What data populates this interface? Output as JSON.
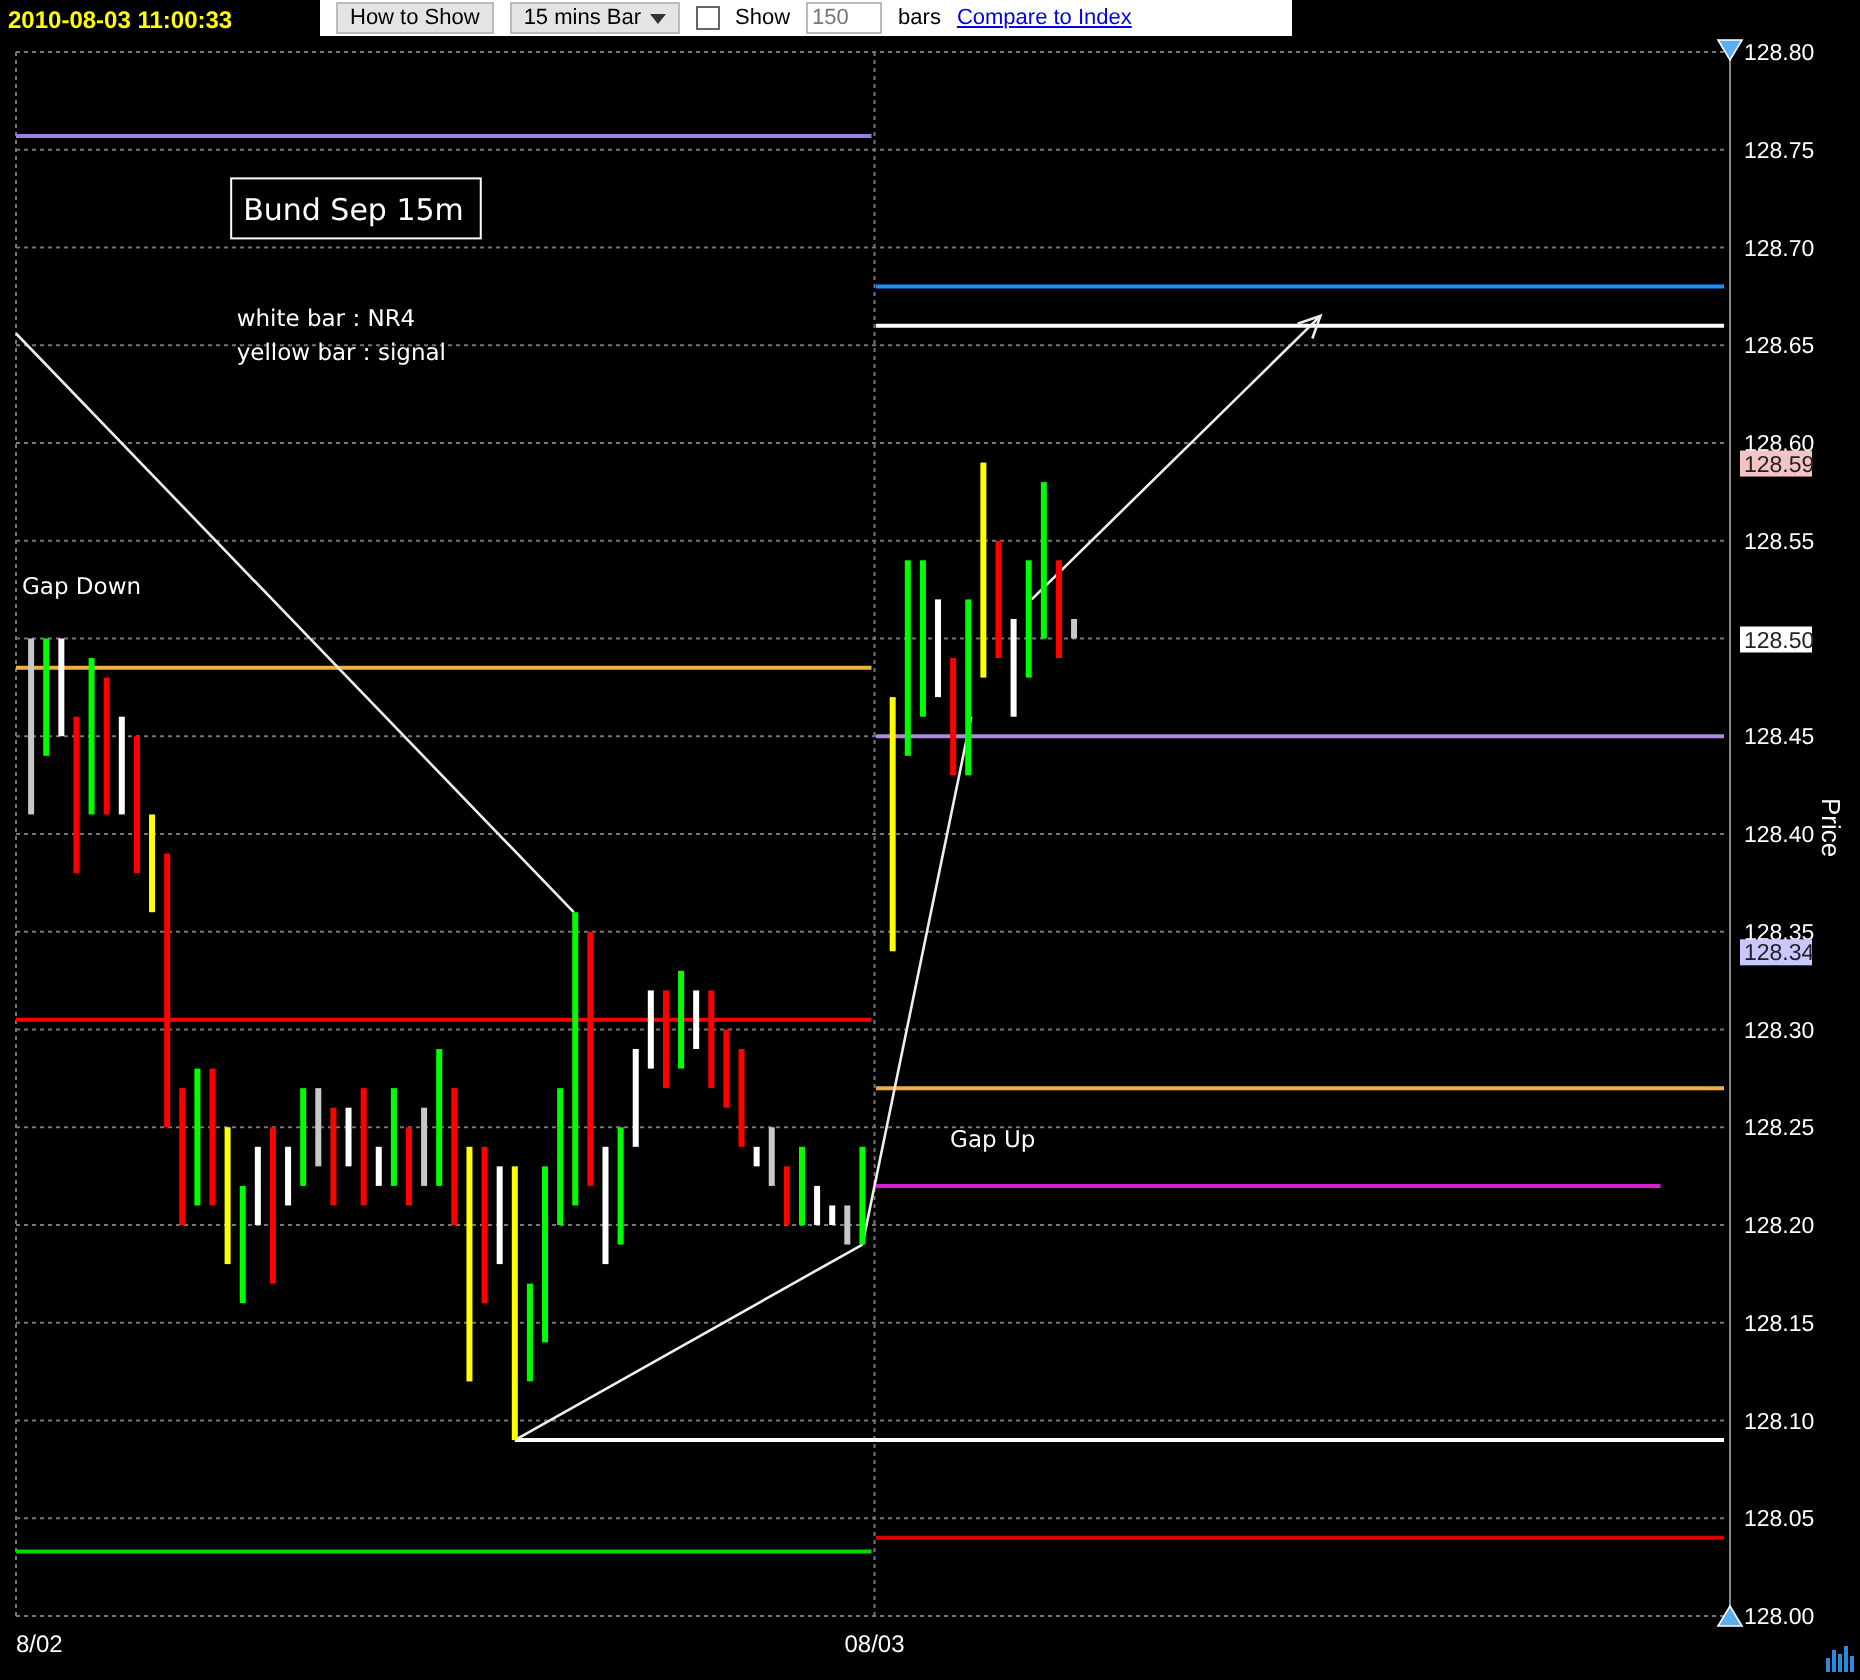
{
  "timestamp": "2010-08-03 11:00:33",
  "toolbar": {
    "view_label": "How to Show",
    "interval": "15 mins Bar",
    "show": {
      "label": "Show",
      "checked": false
    },
    "bar_count": "150",
    "bars_label": "bars",
    "compare_link": "Compare to Index"
  },
  "chart": {
    "title_box": "Bund Sep 15m",
    "legend": [
      "white bar : NR4",
      "yellow bar : signal"
    ],
    "notes": [
      "Gap Down",
      "Gap Up"
    ],
    "axis_title": "Price",
    "price_ticks": [
      "128.80",
      "128.75",
      "128.70",
      "128.65",
      "128.60",
      "128.55",
      "128.45",
      "128.40",
      "128.35",
      "128.30",
      "128.25",
      "128.20",
      "128.15",
      "128.10",
      "128.05",
      "128.00"
    ],
    "date_ticks": [
      "8/02",
      "08/03"
    ],
    "price_tags": [
      {
        "value": "128.59",
        "color": "#f4c4c4"
      },
      {
        "value": "128.50",
        "color": "#ffffff"
      },
      {
        "value": "128.34",
        "color": "#c8c8ff"
      }
    ]
  }
}
